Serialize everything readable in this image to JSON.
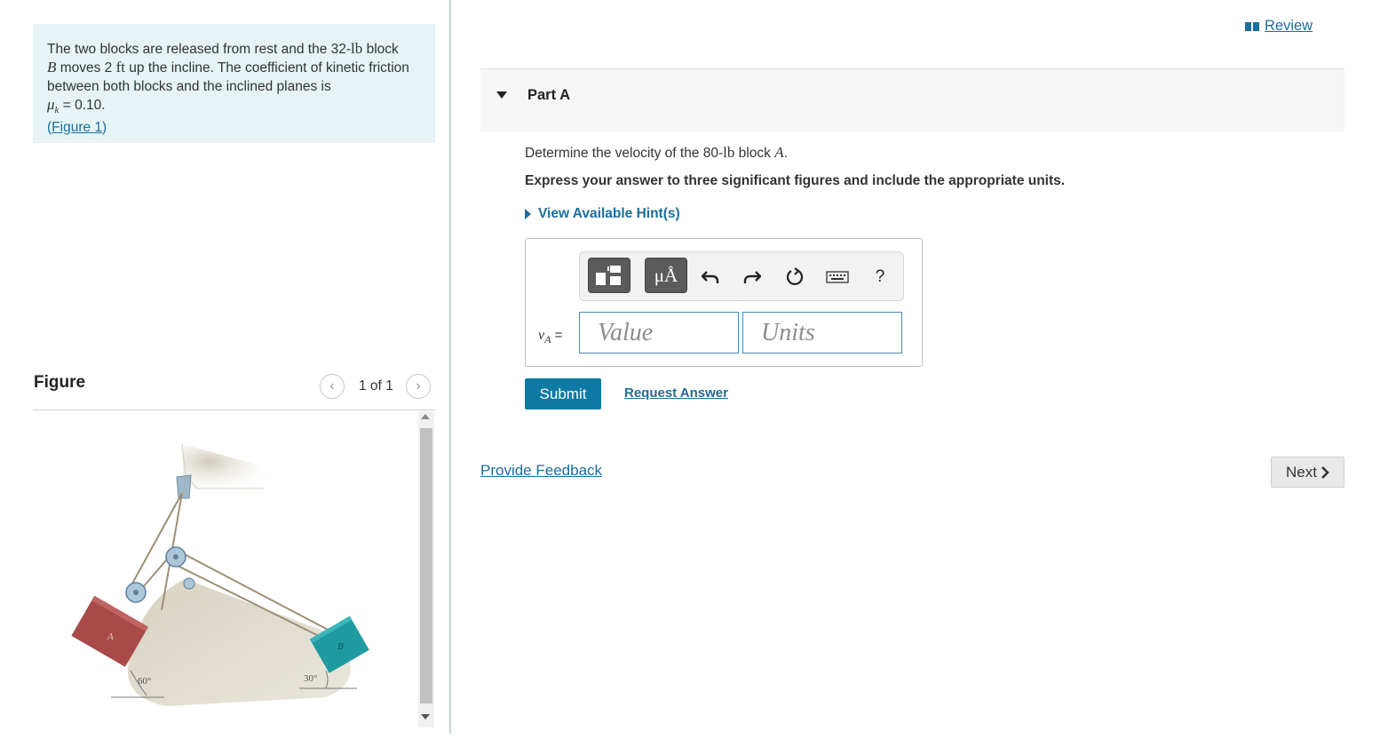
{
  "problem": {
    "t1": "The two blocks are released from rest and the 32-",
    "u_lb": "lb",
    "t2": " block",
    "var_b": "B",
    "t3": " moves 2 ",
    "u_ft": "ft",
    "t4": " up the incline. The coefficient of kinetic friction between both blocks and the inclined planes is",
    "mu": "μ",
    "mu_sub": "k",
    "mu_val": " = 0.10.",
    "figure_link": "Figure 1",
    "paren_open": "(",
    "paren_close": ")"
  },
  "figure": {
    "title": "Figure",
    "counter": "1 of 1",
    "prev_icon": "chevron-left-icon",
    "next_icon": "chevron-right-icon",
    "labels": {
      "block_a": "A",
      "block_b": "B",
      "angle_a": "60°",
      "angle_b": "30°"
    },
    "colors": {
      "block_a": "#a84a48",
      "block_b": "#1f9aa0",
      "incline": "#d9d4c5"
    }
  },
  "header": {
    "review_label": "Review",
    "review_icon": "book-icon"
  },
  "part": {
    "title": "Part A",
    "q1": "Determine the velocity of the 80-",
    "q_unit": "lb",
    "q2": " block ",
    "q_var": "A",
    "q3": ".",
    "instruction": "Express your answer to three significant figures and include the appropriate units.",
    "hints_label": "View Available Hint(s)"
  },
  "answer": {
    "var": "v",
    "var_sub": "A",
    "eq": " =",
    "value_placeholder": "Value",
    "units_placeholder": "Units",
    "toolbar": {
      "templates_icon": "templates-icon",
      "units_label": "μÅ",
      "undo_icon": "undo-icon",
      "redo_icon": "redo-icon",
      "reset_icon": "reset-icon",
      "keyboard_icon": "keyboard-icon",
      "help_label": "?"
    }
  },
  "actions": {
    "submit_label": "Submit",
    "request_answer_label": "Request Answer",
    "provide_feedback_label": "Provide Feedback",
    "next_label": "Next"
  },
  "colors": {
    "accent": "#0e7aa3",
    "link": "#1a6e9c",
    "problem_bg": "#e6f4f6"
  }
}
